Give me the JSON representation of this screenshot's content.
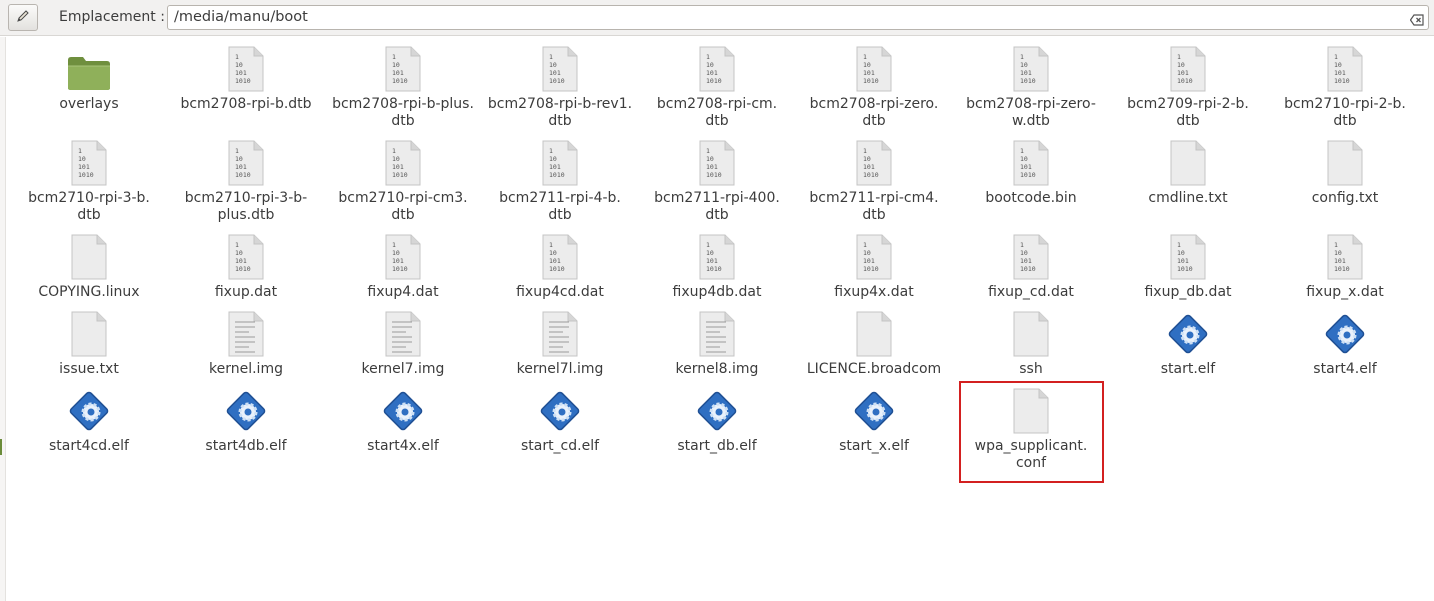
{
  "toolbar": {
    "edit_icon": "pencil-icon",
    "location_label": "Emplacement :",
    "location_value": "/media/manu/boot",
    "clear_icon": "clear-icon"
  },
  "files": [
    {
      "name": "overlays",
      "type": "folder"
    },
    {
      "name": "bcm2708-rpi-b.dtb",
      "type": "binary"
    },
    {
      "name": "bcm2708-rpi-b-plus.dtb",
      "type": "binary"
    },
    {
      "name": "bcm2708-rpi-b-rev1.dtb",
      "type": "binary"
    },
    {
      "name": "bcm2708-rpi-cm.dtb",
      "type": "binary"
    },
    {
      "name": "bcm2708-rpi-zero.dtb",
      "type": "binary"
    },
    {
      "name": "bcm2708-rpi-zero-w.dtb",
      "type": "binary"
    },
    {
      "name": "bcm2709-rpi-2-b.dtb",
      "type": "binary"
    },
    {
      "name": "bcm2710-rpi-2-b.dtb",
      "type": "binary"
    },
    {
      "name": "bcm2710-rpi-3-b.dtb",
      "type": "binary"
    },
    {
      "name": "bcm2710-rpi-3-b-plus.dtb",
      "type": "binary"
    },
    {
      "name": "bcm2710-rpi-cm3.dtb",
      "type": "binary"
    },
    {
      "name": "bcm2711-rpi-4-b.dtb",
      "type": "binary"
    },
    {
      "name": "bcm2711-rpi-400.dtb",
      "type": "binary"
    },
    {
      "name": "bcm2711-rpi-cm4.dtb",
      "type": "binary"
    },
    {
      "name": "bootcode.bin",
      "type": "binary"
    },
    {
      "name": "cmdline.txt",
      "type": "blank"
    },
    {
      "name": "config.txt",
      "type": "blank"
    },
    {
      "name": "COPYING.linux",
      "type": "blank"
    },
    {
      "name": "fixup.dat",
      "type": "binary"
    },
    {
      "name": "fixup4.dat",
      "type": "binary"
    },
    {
      "name": "fixup4cd.dat",
      "type": "binary"
    },
    {
      "name": "fixup4db.dat",
      "type": "binary"
    },
    {
      "name": "fixup4x.dat",
      "type": "binary"
    },
    {
      "name": "fixup_cd.dat",
      "type": "binary"
    },
    {
      "name": "fixup_db.dat",
      "type": "binary"
    },
    {
      "name": "fixup_x.dat",
      "type": "binary"
    },
    {
      "name": "issue.txt",
      "type": "blank"
    },
    {
      "name": "kernel.img",
      "type": "text"
    },
    {
      "name": "kernel7.img",
      "type": "text"
    },
    {
      "name": "kernel7l.img",
      "type": "text"
    },
    {
      "name": "kernel8.img",
      "type": "text"
    },
    {
      "name": "LICENCE.broadcom",
      "type": "blank"
    },
    {
      "name": "ssh",
      "type": "blank"
    },
    {
      "name": "start.elf",
      "type": "executable"
    },
    {
      "name": "start4.elf",
      "type": "executable"
    },
    {
      "name": "start4cd.elf",
      "type": "executable"
    },
    {
      "name": "start4db.elf",
      "type": "executable"
    },
    {
      "name": "start4x.elf",
      "type": "executable"
    },
    {
      "name": "start_cd.elf",
      "type": "executable"
    },
    {
      "name": "start_db.elf",
      "type": "executable"
    },
    {
      "name": "start_x.elf",
      "type": "executable"
    },
    {
      "name": "wpa_supplicant.conf",
      "type": "blank"
    }
  ],
  "binary_icon_text": [
    "1",
    "10",
    "101",
    "1010"
  ],
  "colors": {
    "selection_box": "#d32020",
    "folder": "#7a9b4a",
    "executable": "#3a7fd0"
  },
  "highlighted_file": "wpa_supplicant.conf"
}
